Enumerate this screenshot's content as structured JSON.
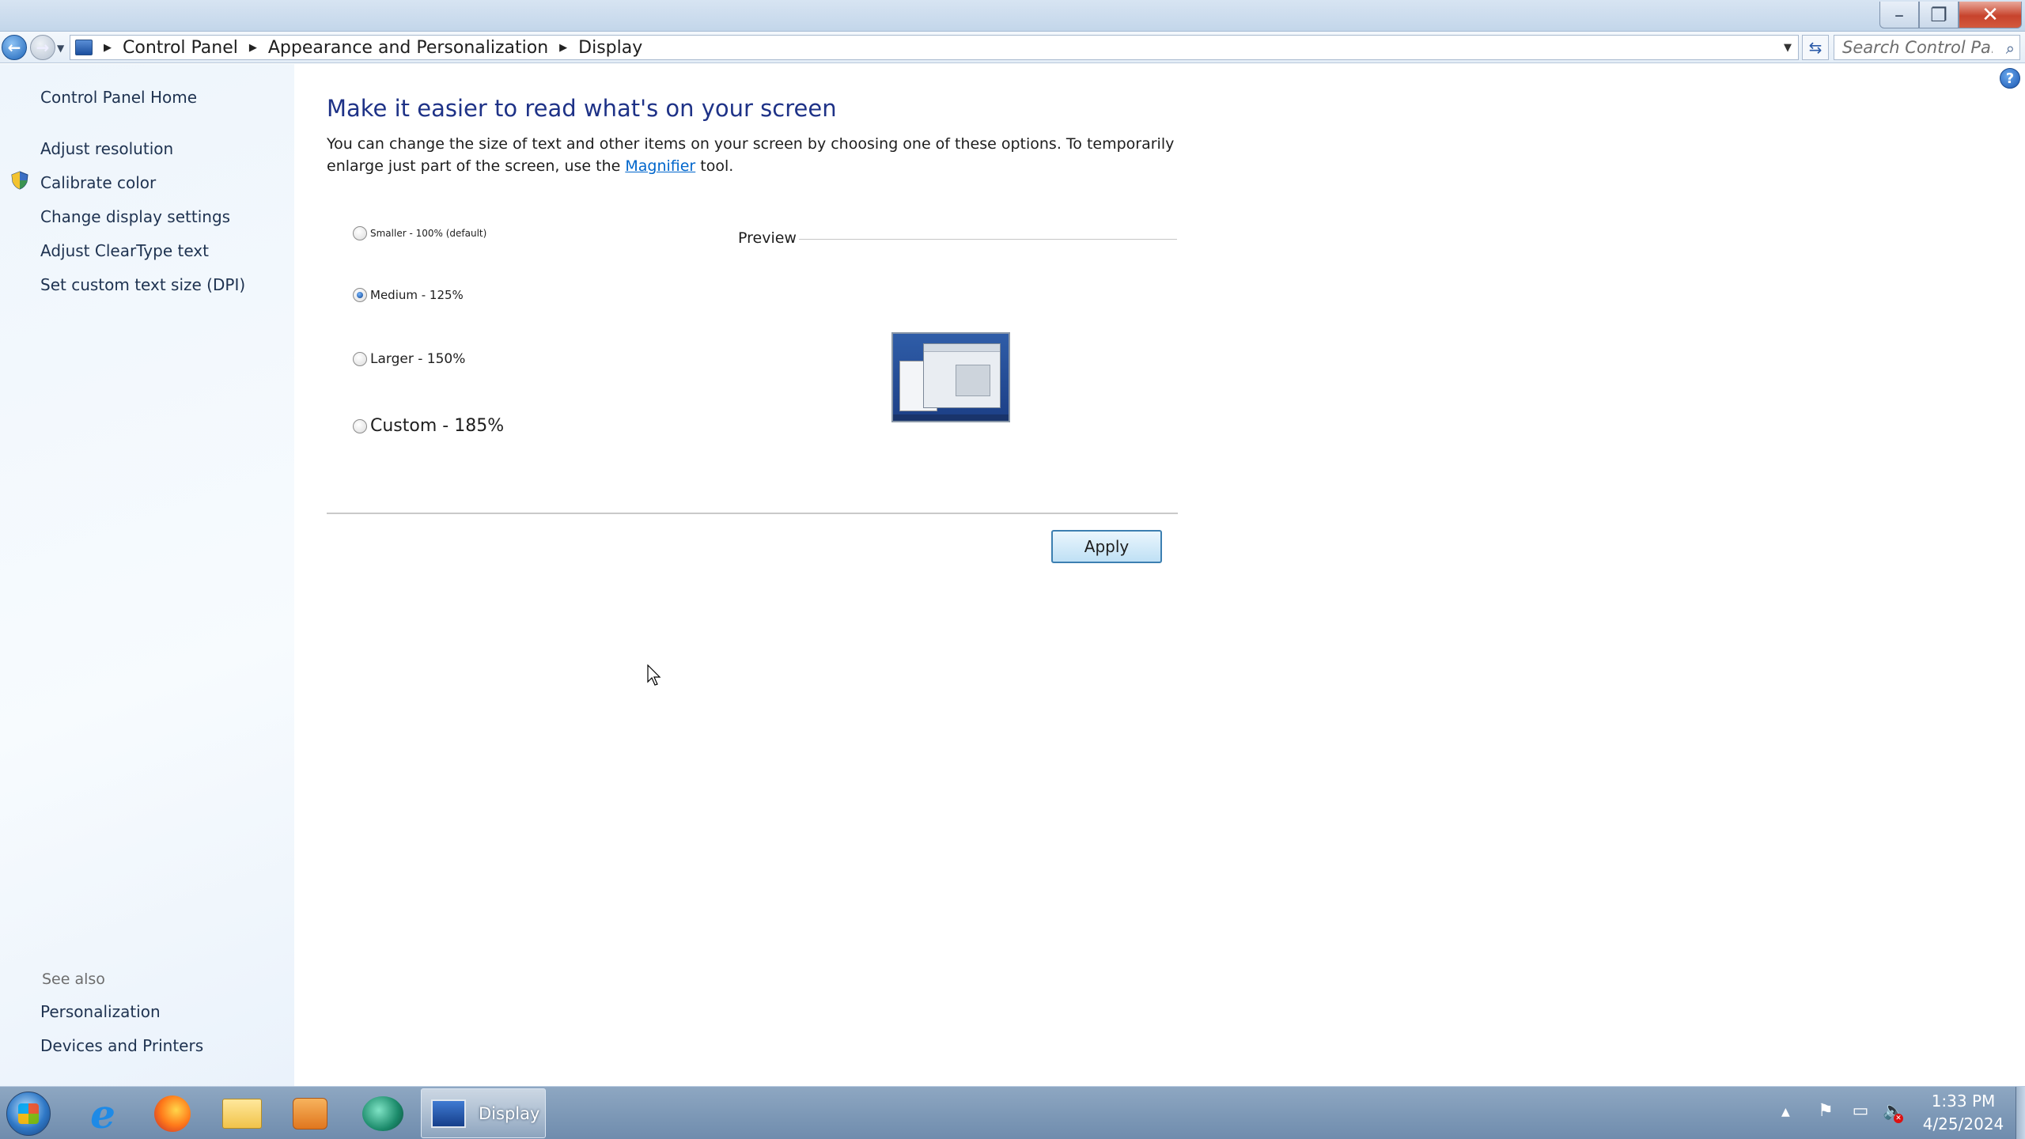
{
  "window": {
    "minimize_glyph": "–",
    "maximize_glyph": "❐",
    "close_glyph": "✕"
  },
  "address_bar": {
    "breadcrumbs": [
      "Control Panel",
      "Appearance and Personalization",
      "Display"
    ],
    "search_placeholder": "Search Control Pa..."
  },
  "sidebar": {
    "home": "Control Panel Home",
    "links": [
      "Adjust resolution",
      "Calibrate color",
      "Change display settings",
      "Adjust ClearType text",
      "Set custom text size (DPI)"
    ],
    "see_also_title": "See also",
    "see_also": [
      "Personalization",
      "Devices and Printers"
    ]
  },
  "main": {
    "title": "Make it easier to read what's on your screen",
    "description_before": "You can change the size of text and other items on your screen by choosing one of these options. To temporarily enlarge just part of the screen, use the ",
    "magnifier_link": "Magnifier",
    "description_after": " tool.",
    "options": [
      {
        "label": "Smaller - 100% (default)",
        "checked": false
      },
      {
        "label": "Medium - 125%",
        "checked": true
      },
      {
        "label": "Larger - 150%",
        "checked": false
      },
      {
        "label": "Custom - 185%",
        "checked": false
      }
    ],
    "preview_label": "Preview",
    "apply_label": "Apply"
  },
  "taskbar": {
    "active_window": "Display",
    "time": "1:33 PM",
    "date": "4/25/2024"
  },
  "icons": {
    "help": "?",
    "refresh": "⇆",
    "search": "⌕",
    "ie": "e",
    "flag": "⚑",
    "network": "▭",
    "volume": "🔈"
  }
}
